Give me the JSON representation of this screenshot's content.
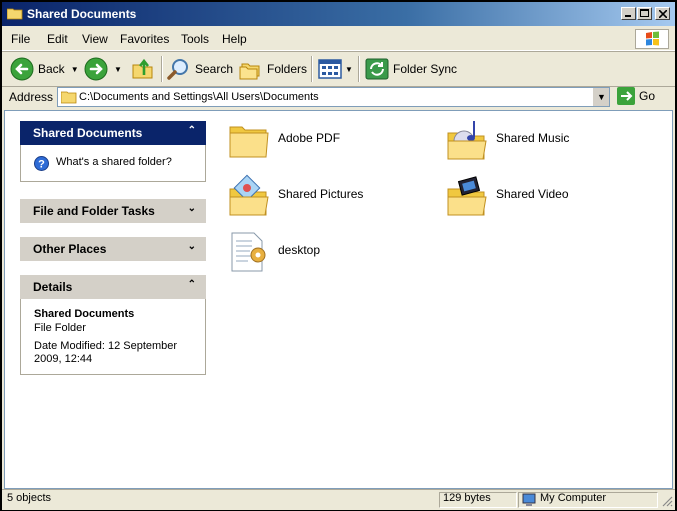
{
  "window": {
    "title": "Shared Documents"
  },
  "menu": [
    "File",
    "Edit",
    "View",
    "Favorites",
    "Tools",
    "Help"
  ],
  "toolbar": {
    "back": "Back",
    "search": "Search",
    "folders": "Folders",
    "folder_sync": "Folder Sync"
  },
  "address": {
    "label": "Address",
    "path": "C:\\Documents and Settings\\All Users\\Documents",
    "go": "Go"
  },
  "task_panels": {
    "shared": {
      "title": "Shared Documents",
      "link": "What's a shared folder?"
    },
    "file_tasks": {
      "title": "File and Folder Tasks"
    },
    "other_places": {
      "title": "Other Places"
    },
    "details": {
      "title": "Details",
      "name": "Shared Documents",
      "type": "File Folder",
      "date_modified": "Date Modified: 12 September 2009, 12:44"
    }
  },
  "files": [
    {
      "label": "Adobe PDF",
      "icon": "folder-icon"
    },
    {
      "label": "Shared Music",
      "icon": "music-folder-icon"
    },
    {
      "label": "Shared Pictures",
      "icon": "pictures-folder-icon"
    },
    {
      "label": "Shared Video",
      "icon": "video-folder-icon"
    },
    {
      "label": "desktop",
      "icon": "config-file-icon"
    }
  ],
  "status": {
    "objects": "5 objects",
    "size": "129 bytes",
    "location": "My Computer"
  }
}
